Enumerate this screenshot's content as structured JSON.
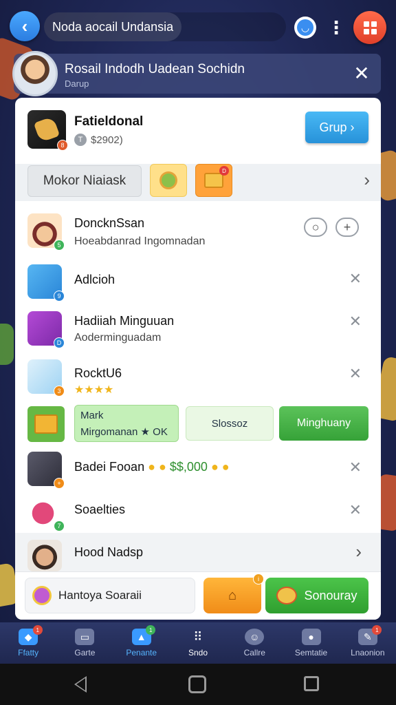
{
  "topbar": {
    "title": "Noda aocail Undansia"
  },
  "notification": {
    "title": "Rosail Indodh Uadean Sochidn",
    "subtitle": "Darup"
  },
  "profile": {
    "name": "Fatieldonal",
    "coin_letter": "T",
    "amount": "$2902)",
    "action_label": "Grup ›"
  },
  "toolbar": {
    "main_label": "Mokor Niaiask"
  },
  "list": [
    {
      "title": "DoncknSsan",
      "subtitle": "Hoeabdanrad Ingomnadan",
      "badge": "5"
    },
    {
      "title": "Adlcioh",
      "badge": "9"
    },
    {
      "title": "Hadiiah Minguuan",
      "subtitle": "Aoderminguadam",
      "badge": "D"
    },
    {
      "title": "RocktU6",
      "rating": "★★★★",
      "badge": "3"
    }
  ],
  "action_row": {
    "mark_line1": "Mark",
    "mark_line2": "Mirgomanan ★ OK",
    "slosso_label": "Slossoz",
    "button_label": "Minghuany"
  },
  "reward_row": {
    "title": "Badei Fooan",
    "amount": "$$,000",
    "badge": "+"
  },
  "socialties": {
    "title": "Soaelties",
    "badge": "7"
  },
  "hood": {
    "title": "Hood Nadsp"
  },
  "bottom_bar": {
    "left_label": "Hantoya Soaraii",
    "right_label": "Sonouray"
  },
  "nav": [
    {
      "label": "Ffatty",
      "icon": "home-icon",
      "badge": "1",
      "active": true
    },
    {
      "label": "Garte",
      "icon": "briefcase-icon"
    },
    {
      "label": "Penante",
      "icon": "trophy-icon",
      "badge": "1",
      "active": true
    },
    {
      "label": "Sndo",
      "icon": "grid-icon"
    },
    {
      "label": "Callre",
      "icon": "smile-icon"
    },
    {
      "label": "Semtatie",
      "icon": "camera-icon"
    },
    {
      "label": "Lnaonion",
      "icon": "chat-icon",
      "badge": "1"
    }
  ],
  "colors": {
    "accent_blue": "#2b7de0",
    "accent_green": "#36a238",
    "accent_orange": "#f08c18",
    "danger_red": "#e0402a"
  }
}
